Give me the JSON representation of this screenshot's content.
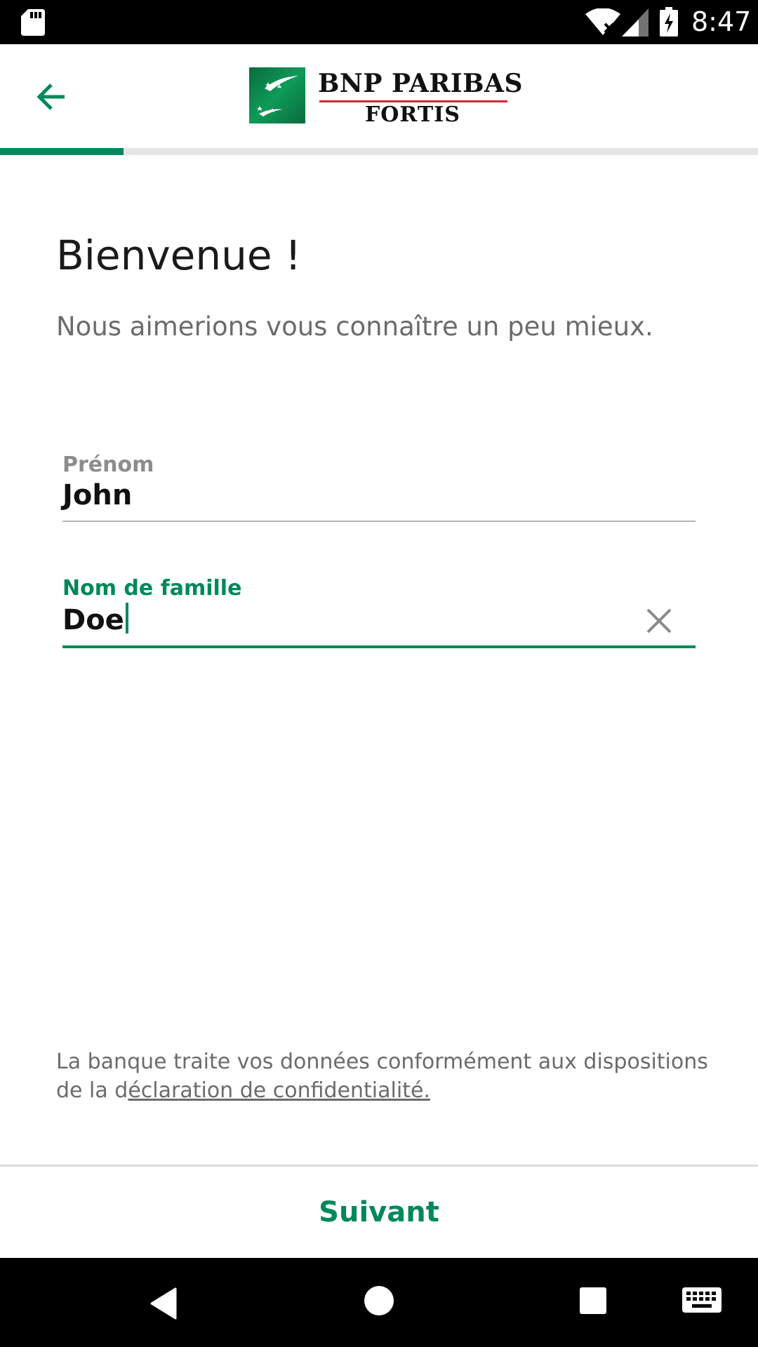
{
  "status_bar": {
    "time": "8:47",
    "icons": [
      "sd-card-icon",
      "wifi-icon",
      "signal-icon",
      "battery-charging-icon"
    ]
  },
  "app_bar": {
    "back_icon": "arrow-left-icon",
    "logo": {
      "line1": "BNP PARIBAS",
      "line2": "FORTIS"
    }
  },
  "progress": {
    "fraction": 0.163
  },
  "content": {
    "title": "Bienvenue !",
    "subtitle": "Nous aimerions vous connaître un peu mieux."
  },
  "form": {
    "first_name": {
      "label": "Prénom",
      "value": "John"
    },
    "last_name": {
      "label": "Nom de famille",
      "value": "Doe",
      "clear_icon": "close-icon"
    }
  },
  "footer": {
    "text_prefix": "La banque traite vos données conformément aux dispositions de la d",
    "link_text": "éclaration de confidentialité."
  },
  "actions": {
    "next_label": "Suivant"
  },
  "nav_bar": {
    "icons": [
      "back-triangle-icon",
      "home-circle-icon",
      "recents-square-icon",
      "keyboard-icon"
    ]
  },
  "colors": {
    "brand_green": "#008859",
    "logo_red": "#d7262f",
    "status_bar_bg": "#000000"
  }
}
